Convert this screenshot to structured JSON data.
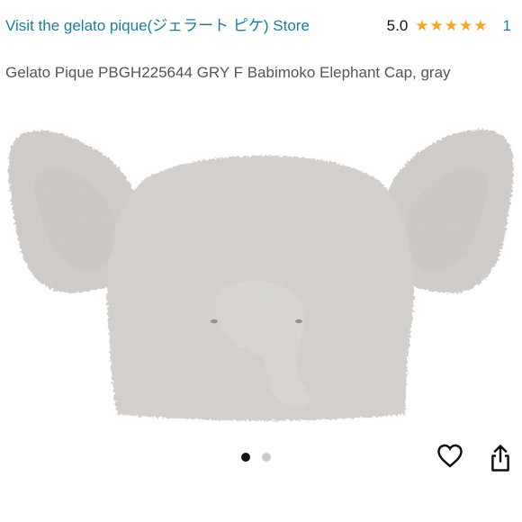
{
  "header": {
    "store_link": "Visit the gelato pique(ジェラート ピケ) Store",
    "rating_value": "5.0",
    "rating_stars": 5,
    "rating_count": "1",
    "product_title": "Gelato Pique PBGH225644 GRY F Babimoko Elephant Cap, gray"
  },
  "product_image": {
    "subject": "gray fluffy elephant cap",
    "color": "#d6d3d1"
  },
  "carousel": {
    "total": 2,
    "current": 1
  },
  "actions": {
    "favorite_icon": "heart-icon",
    "share_icon": "share-icon"
  },
  "colors": {
    "link": "#1a7e9a",
    "star": "#f5a623",
    "text": "#555555"
  }
}
